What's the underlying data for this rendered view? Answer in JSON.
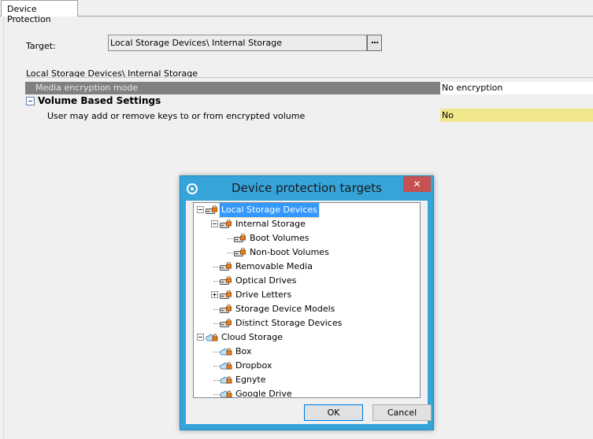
{
  "tab": {
    "label": "Device Protection"
  },
  "form": {
    "target_label": "Target:",
    "target_value": "Local Storage Devices\\ Internal Storage",
    "browse_label": "...",
    "path_label": "Local Storage Devices\\ Internal Storage"
  },
  "properties": {
    "media_label": "Media encryption mode",
    "media_value": "No encryption",
    "group_label": "Volume Based Settings",
    "keys_label": "User may add or remove keys to or from encrypted volume",
    "keys_value": "No"
  },
  "dialog": {
    "title": "Device protection targets",
    "close_glyph": "✕",
    "ok": "OK",
    "cancel": "Cancel",
    "tree": [
      {
        "label": "Local Storage Devices",
        "icon": "storage-lock-icon",
        "selected": true
      },
      {
        "label": "Internal Storage",
        "icon": "storage-lock-icon"
      },
      {
        "label": "Boot Volumes",
        "icon": "storage-lock-icon"
      },
      {
        "label": "Non-boot Volumes",
        "icon": "storage-lock-icon"
      },
      {
        "label": "Removable Media",
        "icon": "storage-lock-icon"
      },
      {
        "label": "Optical Drives",
        "icon": "storage-lock-icon"
      },
      {
        "label": "Drive Letters",
        "icon": "storage-lock-icon"
      },
      {
        "label": "Storage Device Models",
        "icon": "storage-lock-icon"
      },
      {
        "label": "Distinct Storage Devices",
        "icon": "storage-lock-icon"
      },
      {
        "label": "Cloud Storage",
        "icon": "cloud-lock-icon"
      },
      {
        "label": "Box",
        "icon": "cloud-lock-icon"
      },
      {
        "label": "Dropbox",
        "icon": "cloud-lock-icon"
      },
      {
        "label": "Egnyte",
        "icon": "cloud-lock-icon"
      },
      {
        "label": "Google Drive",
        "icon": "cloud-lock-icon"
      }
    ]
  }
}
